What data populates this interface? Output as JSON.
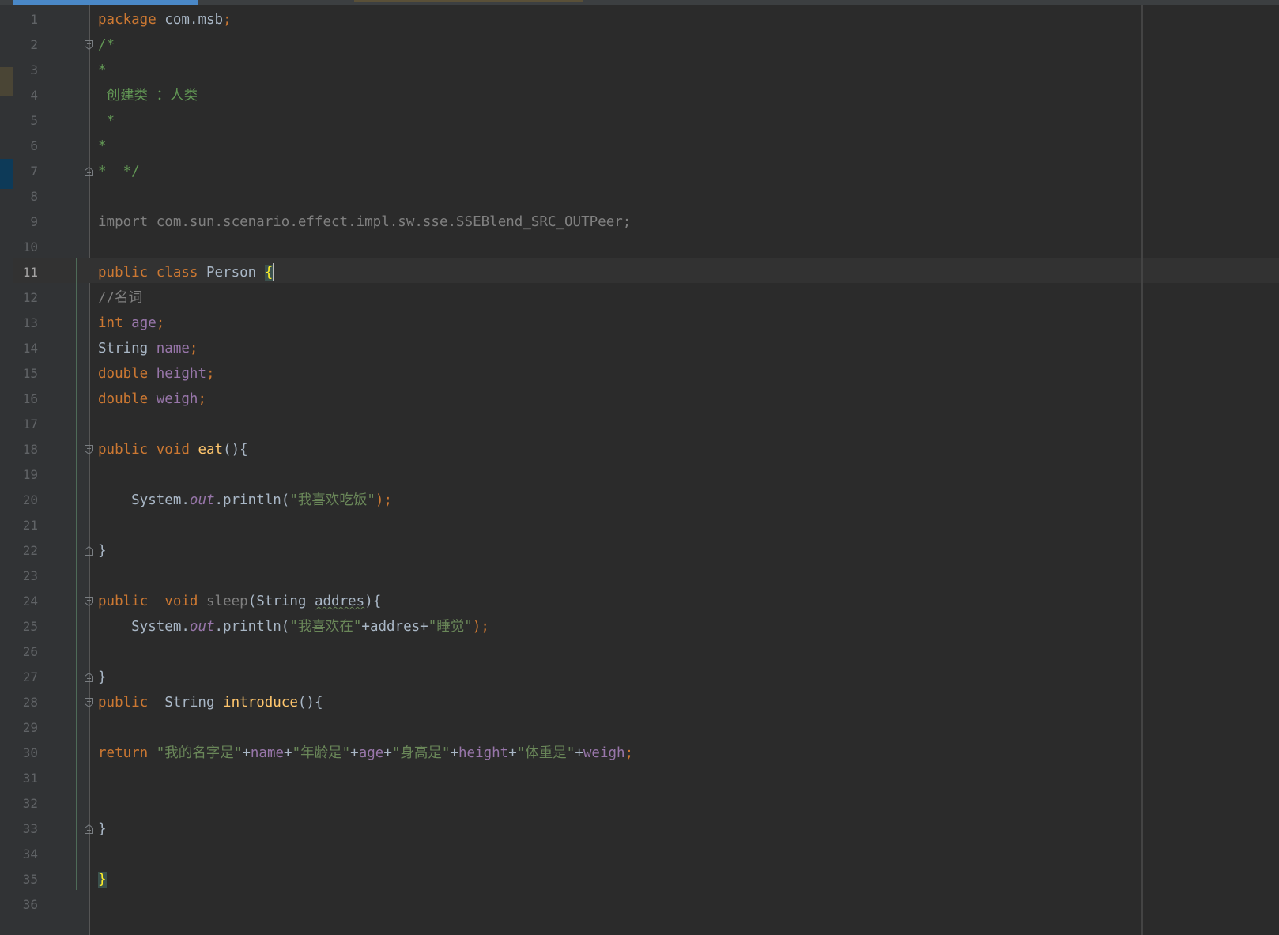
{
  "editor": {
    "language": "java",
    "colors": {
      "background": "#2b2b2b",
      "gutter": "#313335",
      "keyword": "#cc7832",
      "comment": "#629755",
      "string": "#6a8759",
      "field": "#9876aa",
      "method": "#ffc66d",
      "text": "#a9b7c6"
    },
    "current_line": 11,
    "lines": [
      {
        "num": "1",
        "tokens": [
          {
            "t": "package",
            "c": "kw"
          },
          {
            "t": " com.msb",
            "c": "plain"
          },
          {
            "t": ";",
            "c": "kw"
          }
        ]
      },
      {
        "num": "2",
        "fold": "start",
        "tokens": [
          {
            "t": "/*",
            "c": "cm"
          }
        ]
      },
      {
        "num": "3",
        "tokens": [
          {
            "t": "*",
            "c": "cm"
          }
        ]
      },
      {
        "num": "4",
        "tokens": [
          {
            "t": " 创建类 ：人类",
            "c": "cm"
          }
        ]
      },
      {
        "num": "5",
        "tokens": [
          {
            "t": " *",
            "c": "cm"
          }
        ]
      },
      {
        "num": "6",
        "tokens": [
          {
            "t": "*",
            "c": "cm"
          }
        ]
      },
      {
        "num": "7",
        "fold": "end",
        "tokens": [
          {
            "t": "*  */",
            "c": "cm"
          }
        ]
      },
      {
        "num": "8",
        "tokens": []
      },
      {
        "num": "9",
        "tokens": [
          {
            "t": "import com.sun.scenario.effect.impl.sw.sse.SSEBlend_SRC_OUTPeer;",
            "c": "unused"
          }
        ]
      },
      {
        "num": "10",
        "tokens": []
      },
      {
        "num": "11",
        "tokens": [
          {
            "t": "public",
            "c": "kw"
          },
          {
            "t": " ",
            "c": "plain"
          },
          {
            "t": "class",
            "c": "kw"
          },
          {
            "t": " Person ",
            "c": "plain"
          },
          {
            "t": "{",
            "c": "brace-hl"
          },
          {
            "t": "",
            "c": "caret"
          }
        ]
      },
      {
        "num": "12",
        "tokens": [
          {
            "t": "//名词",
            "c": "lc"
          }
        ]
      },
      {
        "num": "13",
        "tokens": [
          {
            "t": "int",
            "c": "kw"
          },
          {
            "t": " ",
            "c": "plain"
          },
          {
            "t": "age",
            "c": "fld"
          },
          {
            "t": ";",
            "c": "kw"
          }
        ]
      },
      {
        "num": "14",
        "tokens": [
          {
            "t": "String ",
            "c": "plain"
          },
          {
            "t": "name",
            "c": "fld"
          },
          {
            "t": ";",
            "c": "kw"
          }
        ]
      },
      {
        "num": "15",
        "tokens": [
          {
            "t": "double",
            "c": "kw"
          },
          {
            "t": " ",
            "c": "plain"
          },
          {
            "t": "height",
            "c": "fld"
          },
          {
            "t": ";",
            "c": "kw"
          }
        ]
      },
      {
        "num": "16",
        "tokens": [
          {
            "t": "double",
            "c": "kw"
          },
          {
            "t": " ",
            "c": "plain"
          },
          {
            "t": "weigh",
            "c": "fld"
          },
          {
            "t": ";",
            "c": "kw"
          }
        ]
      },
      {
        "num": "17",
        "tokens": []
      },
      {
        "num": "18",
        "fold": "start",
        "tokens": [
          {
            "t": "public",
            "c": "kw"
          },
          {
            "t": " ",
            "c": "plain"
          },
          {
            "t": "void",
            "c": "kw"
          },
          {
            "t": " ",
            "c": "plain"
          },
          {
            "t": "eat",
            "c": "mth"
          },
          {
            "t": "(){",
            "c": "plain"
          }
        ]
      },
      {
        "num": "19",
        "tokens": []
      },
      {
        "num": "20",
        "tokens": [
          {
            "t": "    System.",
            "c": "plain"
          },
          {
            "t": "out",
            "c": "fldi"
          },
          {
            "t": ".println(",
            "c": "plain"
          },
          {
            "t": "\"我喜欢吃饭\"",
            "c": "str"
          },
          {
            "t": ");",
            "c": "kw"
          }
        ]
      },
      {
        "num": "21",
        "tokens": []
      },
      {
        "num": "22",
        "fold": "end",
        "tokens": [
          {
            "t": "}",
            "c": "plain"
          }
        ]
      },
      {
        "num": "23",
        "tokens": []
      },
      {
        "num": "24",
        "fold": "start",
        "tokens": [
          {
            "t": "public",
            "c": "kw"
          },
          {
            "t": "  ",
            "c": "plain"
          },
          {
            "t": "void",
            "c": "kw"
          },
          {
            "t": " ",
            "c": "plain"
          },
          {
            "t": "sleep",
            "c": "unused"
          },
          {
            "t": "(String ",
            "c": "plain"
          },
          {
            "t": "addres",
            "c": "squig"
          },
          {
            "t": "){",
            "c": "plain"
          }
        ]
      },
      {
        "num": "25",
        "tokens": [
          {
            "t": "    System.",
            "c": "plain"
          },
          {
            "t": "out",
            "c": "fldi"
          },
          {
            "t": ".println(",
            "c": "plain"
          },
          {
            "t": "\"我喜欢在\"",
            "c": "str"
          },
          {
            "t": "+addres+",
            "c": "plain"
          },
          {
            "t": "\"睡觉\"",
            "c": "str"
          },
          {
            "t": ");",
            "c": "kw"
          }
        ]
      },
      {
        "num": "26",
        "tokens": []
      },
      {
        "num": "27",
        "fold": "end",
        "tokens": [
          {
            "t": "}",
            "c": "plain"
          }
        ]
      },
      {
        "num": "28",
        "fold": "start",
        "tokens": [
          {
            "t": "public",
            "c": "kw"
          },
          {
            "t": "  String ",
            "c": "plain"
          },
          {
            "t": "introduce",
            "c": "mth"
          },
          {
            "t": "(){",
            "c": "plain"
          }
        ]
      },
      {
        "num": "29",
        "tokens": []
      },
      {
        "num": "30",
        "tokens": [
          {
            "t": "return",
            "c": "kw"
          },
          {
            "t": " ",
            "c": "plain"
          },
          {
            "t": "\"我的名字是\"",
            "c": "str"
          },
          {
            "t": "+",
            "c": "plain"
          },
          {
            "t": "name",
            "c": "fld"
          },
          {
            "t": "+",
            "c": "plain"
          },
          {
            "t": "\"年龄是\"",
            "c": "str"
          },
          {
            "t": "+",
            "c": "plain"
          },
          {
            "t": "age",
            "c": "fld"
          },
          {
            "t": "+",
            "c": "plain"
          },
          {
            "t": "\"身高是\"",
            "c": "str"
          },
          {
            "t": "+",
            "c": "plain"
          },
          {
            "t": "height",
            "c": "fld"
          },
          {
            "t": "+",
            "c": "plain"
          },
          {
            "t": "\"体重是\"",
            "c": "str"
          },
          {
            "t": "+",
            "c": "plain"
          },
          {
            "t": "weigh",
            "c": "fld"
          },
          {
            "t": ";",
            "c": "kw"
          }
        ]
      },
      {
        "num": "31",
        "tokens": []
      },
      {
        "num": "32",
        "tokens": []
      },
      {
        "num": "33",
        "fold": "end",
        "tokens": [
          {
            "t": "}",
            "c": "plain"
          }
        ]
      },
      {
        "num": "34",
        "tokens": []
      },
      {
        "num": "35",
        "tokens": [
          {
            "t": "}",
            "c": "brace-hl"
          }
        ]
      },
      {
        "num": "36",
        "tokens": []
      }
    ]
  }
}
